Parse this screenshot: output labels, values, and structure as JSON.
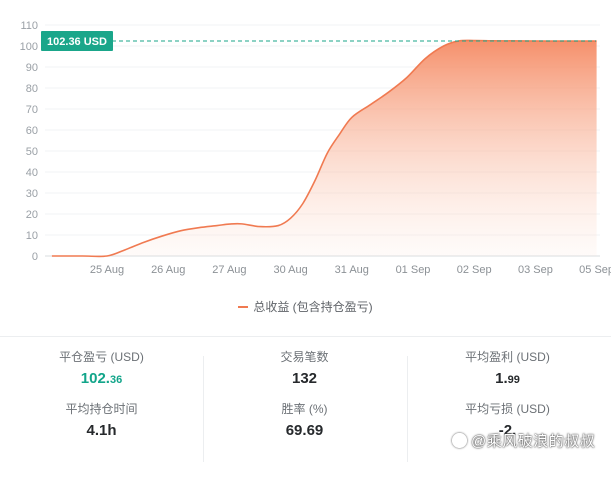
{
  "chart_data": {
    "type": "area",
    "x_labels": [
      "25 Aug",
      "26 Aug",
      "27 Aug",
      "30 Aug",
      "31 Aug",
      "01 Sep",
      "02 Sep",
      "03 Sep",
      "05 Sep"
    ],
    "y_ticks": [
      0,
      10,
      20,
      30,
      40,
      50,
      60,
      70,
      80,
      90,
      100,
      110
    ],
    "ylim": [
      0,
      110
    ],
    "reference_line": {
      "value": 102.36,
      "label": "102.36 USD"
    },
    "series": [
      {
        "name": "总收益 (包含持仓盈亏)",
        "color": "#f07a51",
        "x": [
          -0.9,
          -0.4,
          0,
          0.3,
          0.6,
          0.9,
          1.2,
          1.5,
          1.8,
          2.0,
          2.2,
          2.5,
          2.8,
          3.0,
          3.2,
          3.4,
          3.6,
          3.8,
          4.0,
          4.3,
          4.6,
          4.9,
          5.2,
          5.5,
          5.75,
          6.0,
          6.3,
          6.8,
          7.5,
          8.0
        ],
        "values": [
          0,
          0,
          0,
          3,
          6.5,
          9.5,
          12,
          13.5,
          14.5,
          15.2,
          15.3,
          14,
          14.5,
          18,
          25,
          36,
          49,
          58,
          66,
          72,
          78,
          85,
          94,
          100,
          102.4,
          102.6,
          102.5,
          102.4,
          102.36,
          102.36
        ]
      }
    ],
    "grid": true
  },
  "legend": {
    "label": "总收益 (包含持仓盈亏)"
  },
  "stats": {
    "closed_pnl": {
      "label": "平仓盈亏 (USD)",
      "int": "102.",
      "dec": "36"
    },
    "trade_count": {
      "label": "交易笔数",
      "value": "132"
    },
    "avg_profit": {
      "label": "平均盈利 (USD)",
      "int": "1.",
      "dec": "99"
    },
    "avg_hold_time": {
      "label": "平均持仓时间",
      "value": "4.1h"
    },
    "win_rate": {
      "label": "胜率 (%)",
      "value": "69.69"
    },
    "avg_loss": {
      "label": "平均亏损 (USD)",
      "value": "-2.",
      "dec": ""
    }
  },
  "watermark": {
    "text": "@乘风破浪的叔叔"
  },
  "colors": {
    "accent": "#f07a51",
    "green": "#12a58a",
    "badge": "#1aa68a"
  }
}
